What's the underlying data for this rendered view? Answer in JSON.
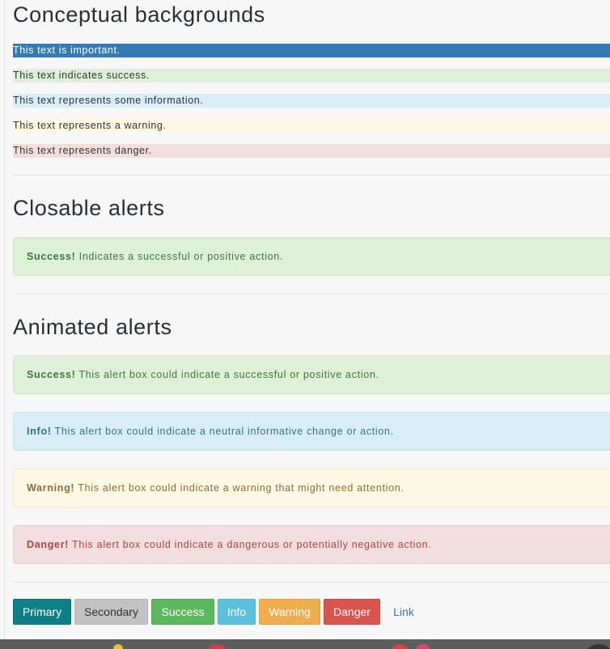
{
  "sections": {
    "backgrounds": {
      "heading": "Conceptual backgrounds",
      "lines": [
        {
          "variant": "primary",
          "text": "This text is important."
        },
        {
          "variant": "success",
          "text": "This text indicates success."
        },
        {
          "variant": "info",
          "text": "This text represents some information."
        },
        {
          "variant": "warning",
          "text": "This text represents a warning."
        },
        {
          "variant": "danger",
          "text": "This text represents danger."
        }
      ]
    },
    "closable": {
      "heading": "Closable alerts",
      "alert": {
        "strong": "Success!",
        "text": " Indicates a successful or positive action."
      }
    },
    "animated": {
      "heading": "Animated alerts",
      "alerts": [
        {
          "variant": "success",
          "strong": "Success!",
          "text": " This alert box could indicate a successful or positive action."
        },
        {
          "variant": "info",
          "strong": "Info!",
          "text": " This alert box could indicate a neutral informative change or action."
        },
        {
          "variant": "warning",
          "strong": "Warning!",
          "text": " This alert box could indicate a warning that might need attention."
        },
        {
          "variant": "danger",
          "strong": "Danger!",
          "text": " This alert box could indicate a dangerous or potentially negative action."
        }
      ]
    }
  },
  "buttons": [
    {
      "label": "Primary",
      "variant": "primary"
    },
    {
      "label": "Secondary",
      "variant": "secondary"
    },
    {
      "label": "Success",
      "variant": "success"
    },
    {
      "label": "Info",
      "variant": "info"
    },
    {
      "label": "Warning",
      "variant": "warning"
    },
    {
      "label": "Danger",
      "variant": "danger"
    },
    {
      "label": "Link",
      "variant": "link"
    }
  ],
  "colors": {
    "primary_bg": "#337ab7",
    "success_bg": "#dff0d8",
    "info_bg": "#d9edf7",
    "warning_bg": "#fcf8e3",
    "danger_bg": "#f2dede",
    "btn_primary": "#0d7f86",
    "btn_success": "#5cb85c",
    "btn_info": "#5bc0de",
    "btn_warning": "#f0ad4e",
    "btn_danger": "#d9534f"
  }
}
